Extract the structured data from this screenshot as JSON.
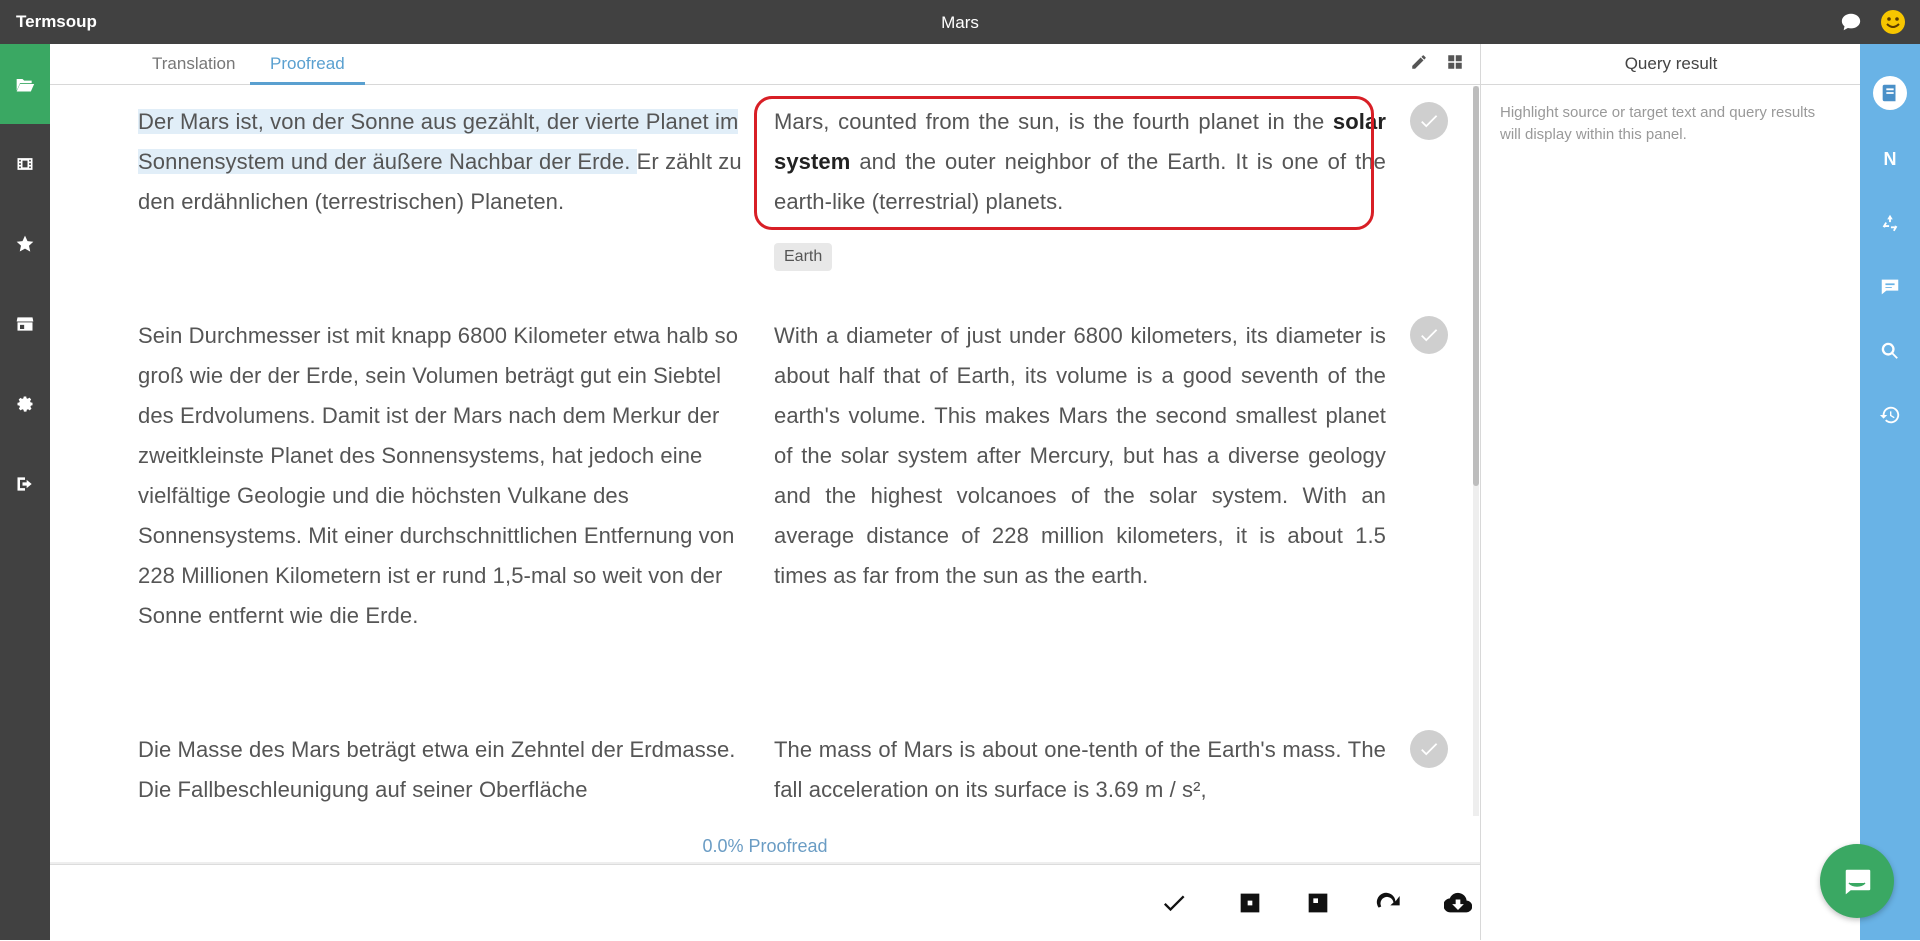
{
  "app": {
    "name": "Termsoup",
    "document_title": "Mars"
  },
  "tabs": [
    {
      "label": "Translation",
      "active": false
    },
    {
      "label": "Proofread",
      "active": true
    }
  ],
  "segments": [
    {
      "source_highlighted": "Der Mars ist, von der Sonne aus gezählt, der vierte Planet im Sonnensystem und der äußere Nachbar der Erde. ",
      "source_rest": "Er zählt zu den erdähnlichen (terrestrischen) Planeten.",
      "target_before": "Mars, counted from the sun, is the fourth planet in the ",
      "target_bold": "solar system",
      "target_after": " and the outer neighbor of the Earth.  It is one of the earth-like (terrestrial) planets.",
      "term_tag": "Earth"
    },
    {
      "source": "Sein Durchmesser ist mit knapp 6800 Kilometer etwa halb so groß wie der der Erde, sein Volumen beträgt gut ein Siebtel des Erdvolumens. Damit ist der Mars nach dem Merkur der zweitkleinste Planet des Sonnensystems, hat jedoch eine vielfältige Geologie und die höchsten Vulkane des Sonnensystems. Mit einer durchschnittlichen Entfernung von 228 Millionen Kilometern ist er rund 1,5-mal so weit von der Sonne entfernt wie die Erde.",
      "target": "With a diameter of just under 6800 kilometers, its diameter is about half that of Earth, its volume is a good seventh of the earth's volume.  This makes Mars the second smallest planet of the solar system after Mercury, but has a diverse geology and the highest volcanoes of the solar system.  With an average distance of 228 million kilometers, it is about 1.5 times as far from the sun as the earth."
    },
    {
      "source": "Die Masse des Mars beträgt etwa ein Zehntel der Erdmasse. Die Fallbeschleunigung auf seiner Oberfläche",
      "target": "The mass of Mars is about one-tenth of the Earth's mass.   The fall acceleration on its surface is 3.69 m / s²,"
    }
  ],
  "progress": {
    "percent_text": "0.0%",
    "label": "Proofread"
  },
  "query_panel": {
    "title": "Query result",
    "hint": "Highlight source or target text and query results will display within this panel."
  },
  "right_sidebar": {
    "n_label": "N"
  },
  "colors": {
    "topbar": "#414141",
    "active_nav": "#3aa863",
    "accent": "#5aa0d0",
    "right_sidebar": "#69b3e6",
    "focus_box": "#d81f26",
    "source_highlight": "#e1eef8"
  },
  "icons": {
    "topbar": [
      "chat-icon",
      "smiley-icon"
    ],
    "left_nav": [
      "folder-open-icon",
      "film-icon",
      "star-icon",
      "store-icon",
      "gear-icon",
      "sign-out-icon"
    ],
    "tab_tools": [
      "pencil-icon",
      "grid-icon"
    ],
    "bottom_tools": [
      "checkmark-icon",
      "square-icon",
      "square-minus-icon",
      "redo-icon",
      "cloud-download-icon"
    ],
    "right_nav": [
      "book-icon",
      "n-icon",
      "recycle-icon",
      "comment-icon",
      "search-icon",
      "history-icon"
    ]
  }
}
